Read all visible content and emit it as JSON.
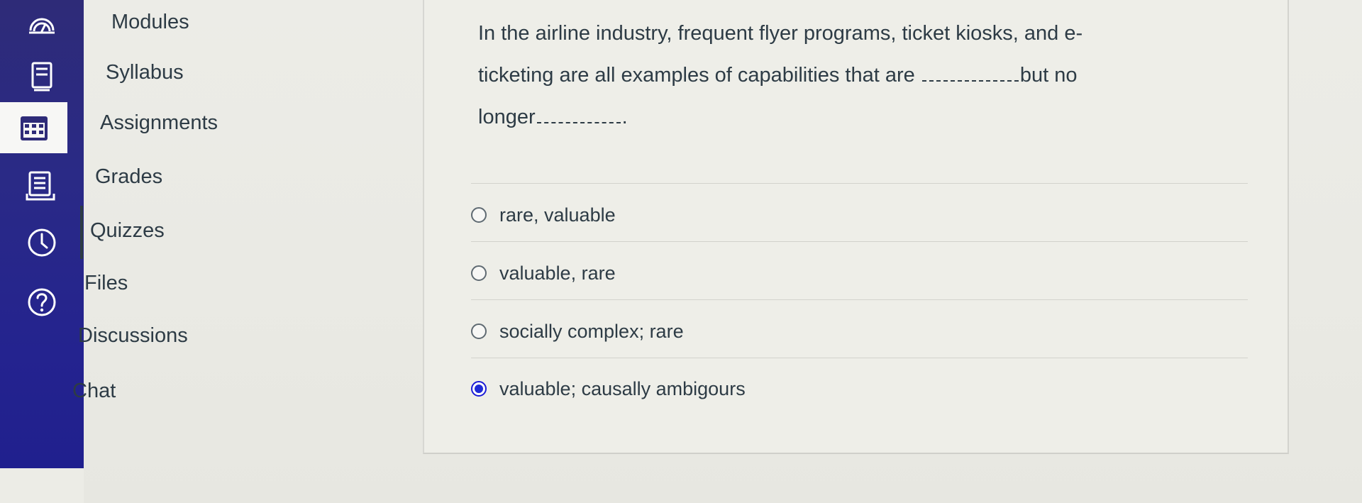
{
  "global_nav": {
    "items": [
      {
        "name": "dashboard",
        "icon": "dashboard-icon"
      },
      {
        "name": "courses",
        "icon": "book-icon"
      },
      {
        "name": "calendar",
        "icon": "calendar-icon"
      },
      {
        "name": "inbox",
        "icon": "inbox-icon"
      },
      {
        "name": "history",
        "icon": "clock-icon"
      },
      {
        "name": "help",
        "icon": "help-icon"
      }
    ]
  },
  "course_nav": {
    "items": [
      {
        "label": "Modules"
      },
      {
        "label": "Syllabus"
      },
      {
        "label": "Assignments"
      },
      {
        "label": "Grades"
      },
      {
        "label": "Quizzes"
      },
      {
        "label": "Files"
      },
      {
        "label": "Discussions"
      },
      {
        "label": "Chat"
      }
    ],
    "active": "Quizzes"
  },
  "question": {
    "part1": "In the airline industry, frequent flyer programs, ticket kiosks, and e-",
    "part2": "ticketing are all examples of capabilities that are",
    "part3": "but no",
    "part4": "longer",
    "part5": ".",
    "answers": [
      {
        "label": "rare, valuable",
        "selected": false
      },
      {
        "label": "valuable, rare",
        "selected": false
      },
      {
        "label": "socially complex; rare",
        "selected": false
      },
      {
        "label": "valuable; causally ambigours",
        "selected": true
      }
    ]
  },
  "colors": {
    "rail": "#2a2a86",
    "text": "#2d3b45",
    "radio_selected": "#1f2bd6"
  }
}
